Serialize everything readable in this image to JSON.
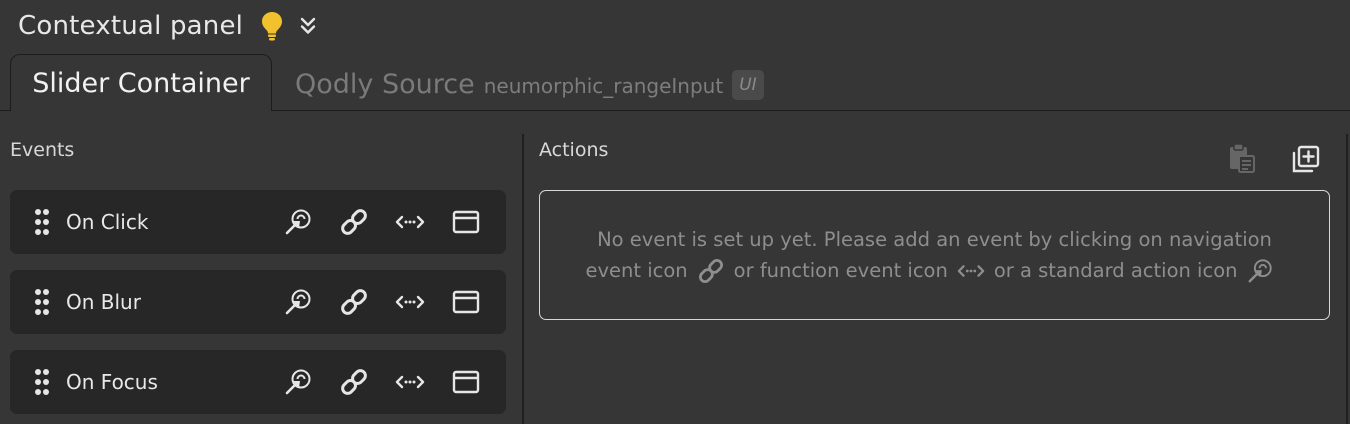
{
  "header": {
    "title": "Contextual panel",
    "bulb_icon": "lightbulb-icon",
    "collapse_icon": "double-chevron-down-icon",
    "bulb_color": "#f2c12e"
  },
  "tabs": {
    "active_label": "Slider Container",
    "source_label": "Qodly Source",
    "source_name": "neumorphic_rangeInput",
    "source_badge": "UI"
  },
  "events": {
    "label": "Events",
    "items": [
      {
        "label": "On Click"
      },
      {
        "label": "On Blur"
      },
      {
        "label": "On Focus"
      }
    ],
    "row_icons": [
      "standard-action-icon",
      "navigation-event-link-icon",
      "function-event-icon",
      "window-icon"
    ]
  },
  "actions": {
    "label": "Actions",
    "empty_line1": "No event is set up yet. Please add an event by clicking on navigation",
    "empty_line2_a": "event icon",
    "empty_line2_b": "or function event icon",
    "empty_line2_c": "or a standard action icon"
  }
}
